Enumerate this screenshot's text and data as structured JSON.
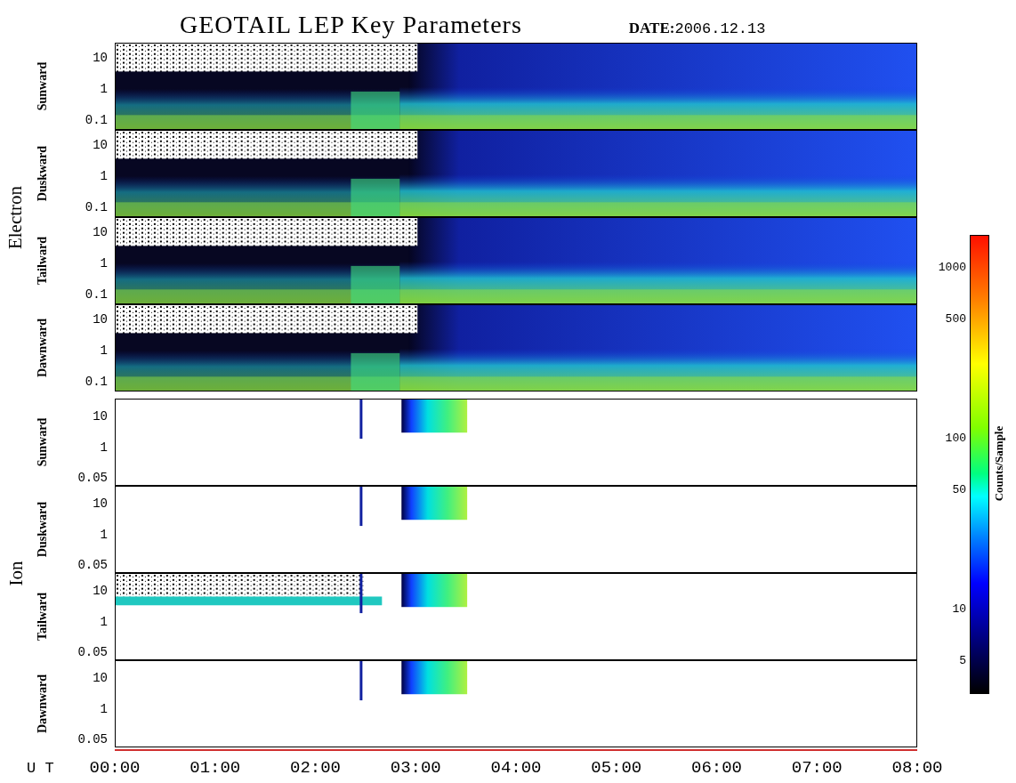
{
  "title": "GEOTAIL LEP Key Parameters",
  "date_label": "DATE:",
  "date": "2006.12.13",
  "groups": [
    {
      "species": "Electron",
      "kind": "electron",
      "panels": [
        {
          "direction": "Sunward",
          "yticks": [
            "10",
            "1",
            "0.1"
          ]
        },
        {
          "direction": "Duskward",
          "yticks": [
            "10",
            "1",
            "0.1"
          ]
        },
        {
          "direction": "Tailward",
          "yticks": [
            "10",
            "1",
            "0.1"
          ]
        },
        {
          "direction": "Dawnward",
          "yticks": [
            "10",
            "1",
            "0.1"
          ]
        }
      ]
    },
    {
      "species": "Ion",
      "kind": "ion",
      "panels": [
        {
          "direction": "Sunward",
          "yticks": [
            "10",
            "1",
            "0.05"
          ]
        },
        {
          "direction": "Duskward",
          "yticks": [
            "10",
            "1",
            "0.05"
          ]
        },
        {
          "direction": "Tailward",
          "yticks": [
            "10",
            "1",
            "0.05"
          ]
        },
        {
          "direction": "Dawnward",
          "yticks": [
            "10",
            "1",
            "0.05"
          ]
        }
      ]
    }
  ],
  "colorbar": {
    "label": "Counts/Sample",
    "ticks": [
      "1000",
      "500",
      "100",
      "50",
      "10",
      "5"
    ]
  },
  "time_axis": {
    "label": "U T",
    "ticks": [
      "00:00",
      "01:00",
      "02:00",
      "03:00",
      "04:00",
      "05:00",
      "06:00",
      "07:00",
      "08:00"
    ]
  }
}
